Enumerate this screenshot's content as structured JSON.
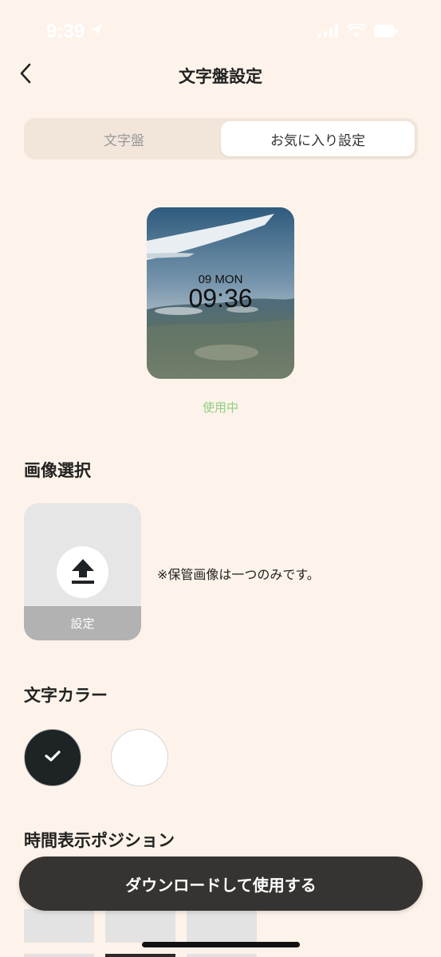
{
  "status_bar": {
    "time": "9:39"
  },
  "header": {
    "title": "文字盤設定"
  },
  "tabs": [
    {
      "label": "文字盤",
      "active": false
    },
    {
      "label": "お気に入り設定",
      "active": true
    }
  ],
  "preview": {
    "date": "09 MON",
    "time": "09:36",
    "status": "使用中"
  },
  "image_select": {
    "title": "画像選択",
    "upload_label": "設定",
    "note": "※保管画像は一つのみです。"
  },
  "text_color": {
    "title": "文字カラー",
    "options": [
      {
        "color": "#1e2326",
        "selected": true
      },
      {
        "color": "#ffffff",
        "selected": false
      }
    ]
  },
  "time_position": {
    "title": "時間表示ポジション"
  },
  "download_button": {
    "label": "ダウンロードして使用する"
  },
  "colors": {
    "background": "#fdf3ea",
    "accent_green": "#8fcf83",
    "button_dark": "#363432"
  }
}
